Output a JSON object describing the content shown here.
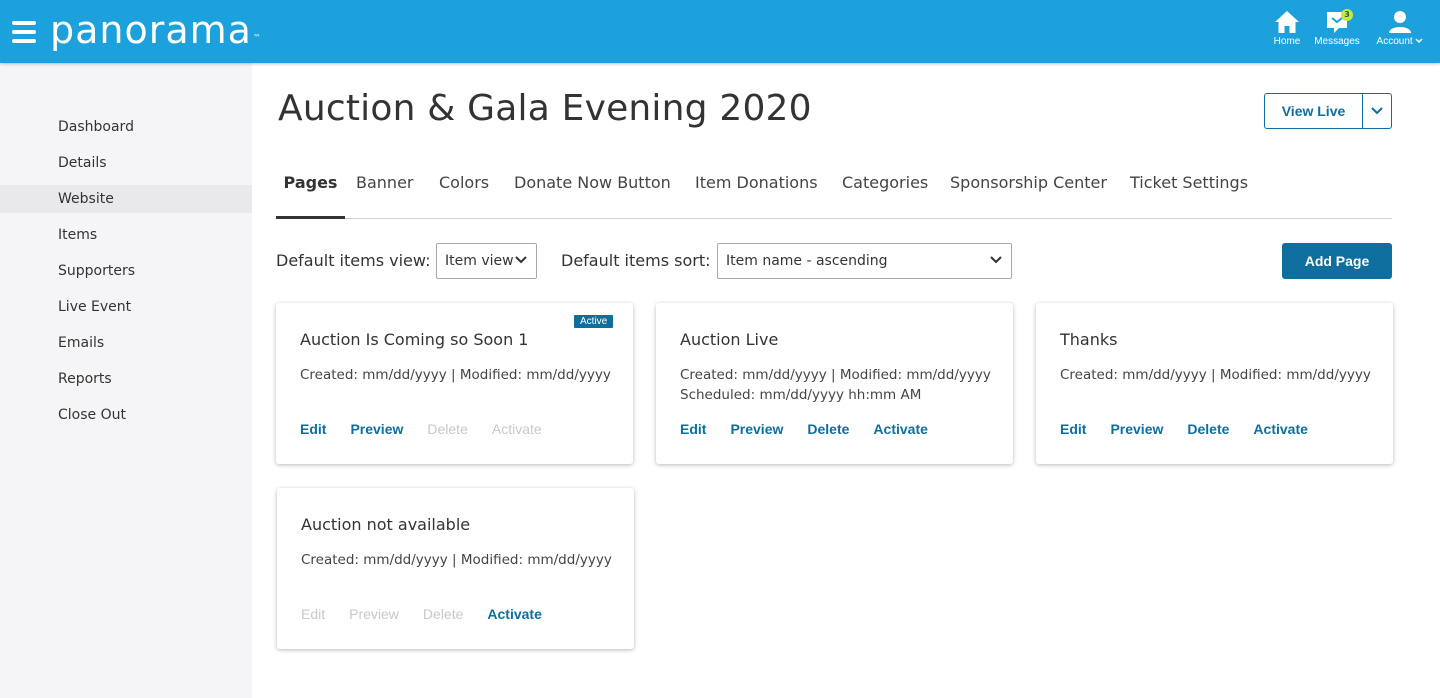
{
  "brand": {
    "name": "panorama",
    "tm": "™"
  },
  "topnav": {
    "home_label": "Home",
    "messages_label": "Messages",
    "messages_count": "3",
    "account_label": "Account"
  },
  "sidebar": {
    "items": [
      {
        "label": "Dashboard"
      },
      {
        "label": "Details"
      },
      {
        "label": "Website"
      },
      {
        "label": "Items"
      },
      {
        "label": "Supporters"
      },
      {
        "label": "Live Event"
      },
      {
        "label": "Emails"
      },
      {
        "label": "Reports"
      },
      {
        "label": "Close Out"
      }
    ],
    "active": "Website"
  },
  "page": {
    "title": "Auction & Gala Evening 2020",
    "view_live_label": "View Live"
  },
  "tabs": [
    {
      "label": "Pages"
    },
    {
      "label": "Banner"
    },
    {
      "label": "Colors"
    },
    {
      "label": "Donate Now Button"
    },
    {
      "label": "Item Donations"
    },
    {
      "label": "Categories"
    },
    {
      "label": "Sponsorship Center"
    },
    {
      "label": "Ticket Settings"
    }
  ],
  "filters": {
    "view_label": "Default items view:",
    "view_value": "Item view",
    "sort_label": "Default items sort:",
    "sort_value": "Item name - ascending"
  },
  "add_page_label": "Add Page",
  "cards": [
    {
      "title": "Auction Is Coming so Soon 1",
      "badge": "Active",
      "created": "Created: mm/dd/yyyy | Modified: mm/dd/yyyy",
      "scheduled": "",
      "actions": {
        "edit": "Edit",
        "preview": "Preview",
        "delete": "Delete",
        "activate": "Activate"
      }
    },
    {
      "title": "Auction Live",
      "badge": "",
      "created": "Created: mm/dd/yyyy | Modified: mm/dd/yyyy",
      "scheduled": "Scheduled: mm/dd/yyyy hh:mm AM",
      "actions": {
        "edit": "Edit",
        "preview": "Preview",
        "delete": "Delete",
        "activate": "Activate"
      }
    },
    {
      "title": "Thanks",
      "badge": "",
      "created": "Created: mm/dd/yyyy | Modified: mm/dd/yyyy",
      "scheduled": "",
      "actions": {
        "edit": "Edit",
        "preview": "Preview",
        "delete": "Delete",
        "activate": "Activate"
      }
    },
    {
      "title": "Auction not available",
      "badge": "",
      "created": "Created: mm/dd/yyyy | Modified: mm/dd/yyyy",
      "scheduled": "",
      "actions": {
        "edit": "Edit",
        "preview": "Preview",
        "delete": "Delete",
        "activate": "Activate"
      }
    }
  ],
  "colors": {
    "topbar": "#1da1dd",
    "accent": "#0e6f9e",
    "sidebar_bg": "#f5f5f7",
    "disabled": "#c8c8c8",
    "badge_bg": "#c8e64b"
  },
  "icons": [
    "hamburger-menu-icon",
    "home-icon",
    "messages-icon",
    "account-icon",
    "chevron-down-icon"
  ]
}
